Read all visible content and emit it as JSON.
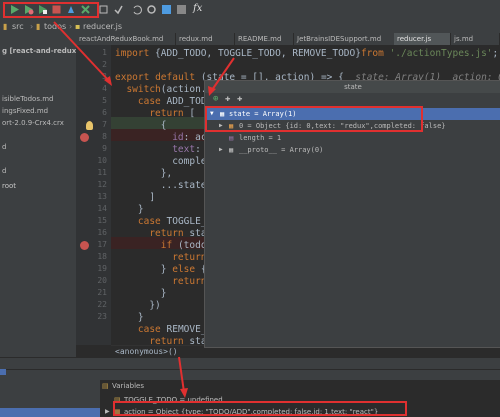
{
  "toolbar": {
    "icons": [
      "run-icon",
      "debug-icon",
      "coverage-icon",
      "stop-icon",
      "profile-icon",
      "build-icon",
      "commit-icon",
      "update-icon",
      "undo-icon",
      "settings-icon",
      "structure-icon",
      "sdk-icon",
      "function-icon"
    ],
    "fx_label": "fx"
  },
  "breadcrumb": {
    "items": [
      "src",
      "todos",
      "reducer.js"
    ]
  },
  "project": {
    "header": "g [react-and-redux",
    "items": [
      "isibleTodos.md",
      "ingsFixed.md",
      "ort-2.0.9-Crx4.crx",
      "d",
      "d",
      "root"
    ]
  },
  "tabs": [
    {
      "label": "reactAndReduxBook.md",
      "active": false
    },
    {
      "label": "redux.md",
      "active": false
    },
    {
      "label": "README.md",
      "active": false
    },
    {
      "label": "JetBrainsIDESupport.md",
      "active": false
    },
    {
      "label": "reducer.js",
      "active": true
    },
    {
      "label": "js.md",
      "active": false
    }
  ],
  "editor": {
    "line_numbers": [
      "1",
      "2",
      "3",
      "4",
      "5",
      "6",
      "7",
      "8",
      "9",
      "10",
      "11",
      "12",
      "13",
      "14",
      "15",
      "16",
      "17",
      "18",
      "19",
      "20",
      "21",
      "22",
      "23"
    ],
    "lines": [
      {
        "t": "import {ADD_TODO, TOGGLE_TODO, REMOVE_TODO}from './actionTypes.js';  ADD_TODO: "
      },
      {
        "t": ""
      },
      {
        "t": "export default (state = [], action) => {  state: Array(1)  action: Object {type:"
      },
      {
        "t": "  switch(action.typ"
      },
      {
        "t": "    case ADD_TODO:"
      },
      {
        "t": "      return ["
      },
      {
        "t": "        {"
      },
      {
        "t": "          id: action"
      },
      {
        "t": "          text: acti"
      },
      {
        "t": "          completed"
      },
      {
        "t": "        },"
      },
      {
        "t": "        ...state"
      },
      {
        "t": "      ]"
      },
      {
        "t": "    }"
      },
      {
        "t": "    case TOGGLE_TOD"
      },
      {
        "t": "      return state."
      },
      {
        "t": "        if (todoIte"
      },
      {
        "t": "          return {"
      },
      {
        "t": "        } else {"
      },
      {
        "t": "          return to"
      },
      {
        "t": "        }"
      },
      {
        "t": "      })"
      },
      {
        "t": "    }"
      },
      {
        "t": "    case REMOVE_TOD"
      },
      {
        "t": "      return state."
      }
    ],
    "status": "<anonymous>()"
  },
  "popup": {
    "title": "state",
    "rows": [
      {
        "label": "state = Array(1)",
        "indent": 0,
        "expanded": true,
        "selected": true
      },
      {
        "label": "0 = Object {id: 0,text: \"redux\",completed: false}",
        "indent": 1,
        "expanded": false,
        "selected": false
      },
      {
        "label": "length = 1",
        "indent": 1,
        "expanded": false,
        "selected": false
      },
      {
        "label": "__proto__ = Array(0)",
        "indent": 1,
        "expanded": false,
        "selected": false
      }
    ]
  },
  "debugger": {
    "variables_label": "Variables",
    "vars": [
      {
        "label": "TOGGLE_TODO = undefined"
      },
      {
        "label": "action = Object {type: \"TODO/ADD\",completed: false,id: 1,text: \"react\"}"
      }
    ]
  },
  "colors": {
    "accent_red": "#e03030",
    "selection_blue": "#4b6eaf",
    "breakpoint_red": "#c75450"
  }
}
